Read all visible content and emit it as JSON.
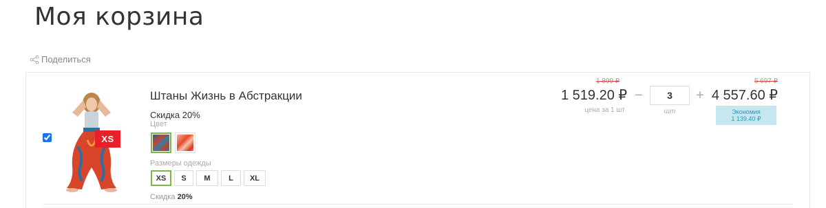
{
  "page": {
    "title": "Моя корзина"
  },
  "share": {
    "label": "Поделиться",
    "icon": "share-icon"
  },
  "item": {
    "selected": true,
    "name": "Штаны Жизнь в Абстракции",
    "discount_title": "Скидка 20%",
    "image_badge": "XS",
    "color_label": "Цвет",
    "colors": [
      {
        "name": "swatch-blue-red",
        "selected": true
      },
      {
        "name": "swatch-orange-red",
        "selected": false
      }
    ],
    "sizes_label": "Размеры одежды",
    "sizes": [
      "XS",
      "S",
      "M",
      "L",
      "XL"
    ],
    "selected_size": "XS",
    "discount_bottom_label": "Скидка",
    "discount_bottom_value": "20%",
    "old_unit_price": "1 899 ₽",
    "unit_price": "1 519.20 ₽",
    "unit_caption": "цена за 1 шт",
    "qty_minus": "−",
    "quantity": "3",
    "qty_plus": "+",
    "qty_unit": "шт",
    "old_total": "5 697 ₽",
    "total": "4 557.60 ₽",
    "savings_label": "Экономия",
    "savings_value": "1 139.40 ₽"
  },
  "colors": {
    "accent_green": "#7ab648",
    "badge_red": "#e8202a",
    "savings_bg": "#c7e7ef",
    "savings_text": "#2a97c2"
  }
}
